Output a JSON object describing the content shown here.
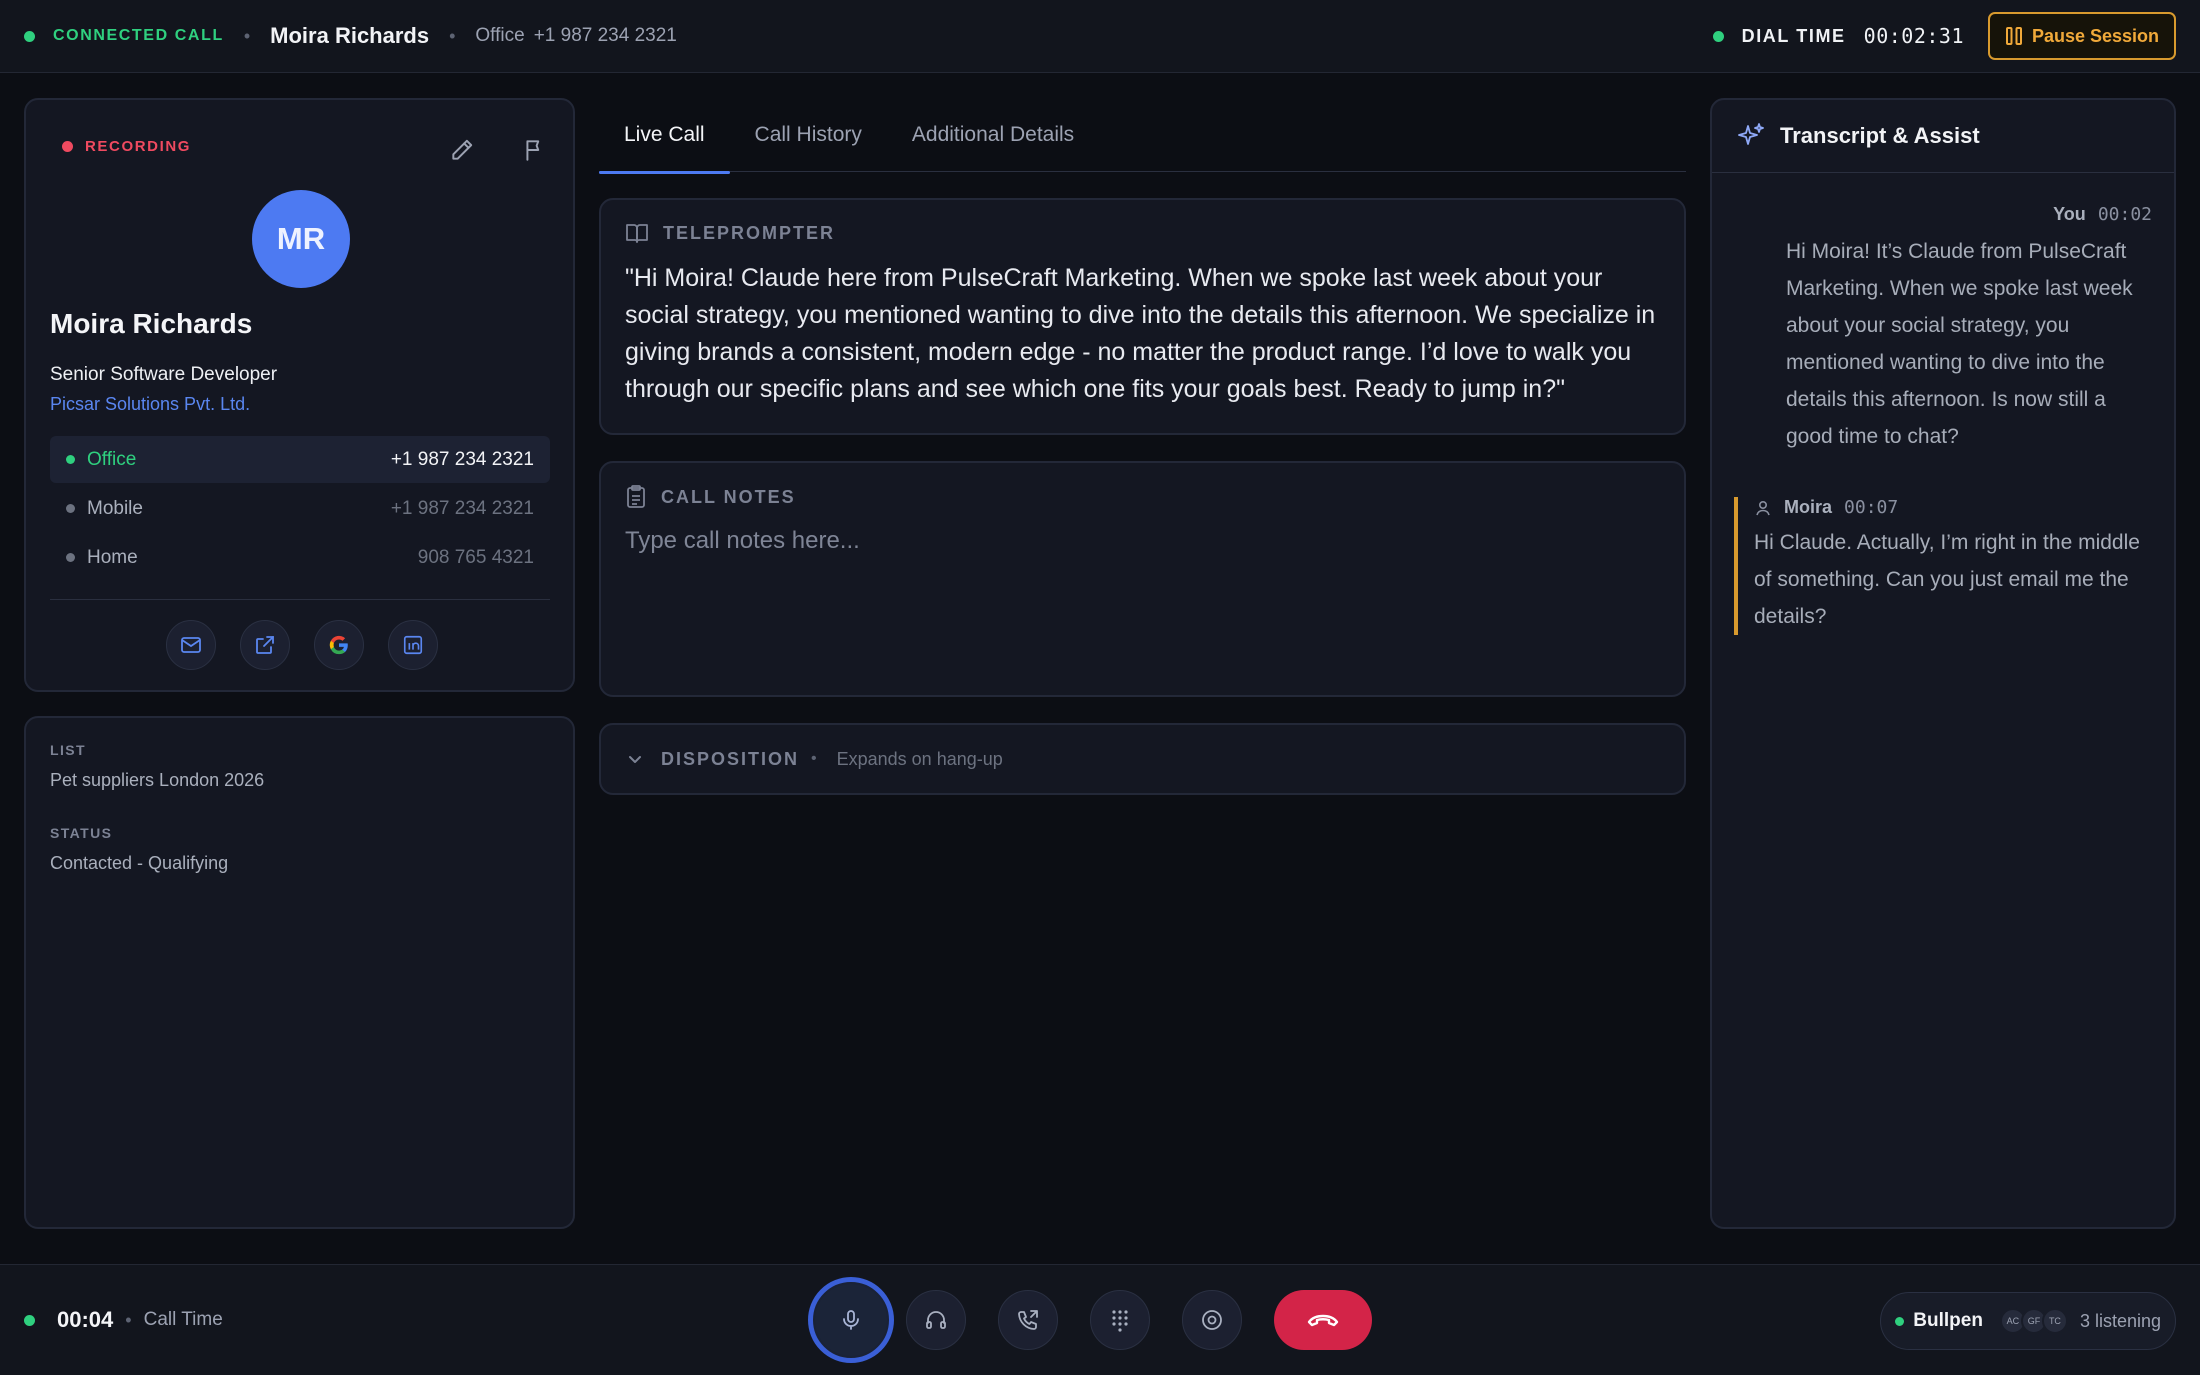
{
  "topbar": {
    "status": "CONNECTED CALL",
    "contact_name": "Moira Richards",
    "line_type": "Office",
    "line_number": "+1 987 234 2321",
    "dial_label": "DIAL TIME",
    "dial_time": "00:02:31",
    "pause_label": "Pause Session"
  },
  "contact": {
    "recording_label": "RECORDING",
    "initials": "MR",
    "name": "Moira Richards",
    "title": "Senior Software Developer",
    "company": "Picsar Solutions Pvt. Ltd.",
    "phones": [
      {
        "label": "Office",
        "number": "+1 987 234 2321",
        "active": true
      },
      {
        "label": "Mobile",
        "number": "+1 987 234 2321",
        "active": false
      },
      {
        "label": "Home",
        "number": "908 765 4321",
        "active": false
      }
    ],
    "social_icons": [
      "mail-icon",
      "external-link-icon",
      "google-icon",
      "linkedin-icon"
    ]
  },
  "meta": {
    "list_label": "LIST",
    "list_value": "Pet suppliers London 2026",
    "status_label": "STATUS",
    "status_value": "Contacted - Qualifying"
  },
  "tabs": [
    {
      "label": "Live Call",
      "active": true
    },
    {
      "label": "Call History",
      "active": false
    },
    {
      "label": "Additional Details",
      "active": false
    }
  ],
  "teleprompter": {
    "title": "TELEPROMPTER",
    "text": "\"Hi Moira! Claude here from PulseCraft Marketing. When we spoke last week about your social strategy, you mentioned wanting to dive into the details this afternoon. We specialize in giving brands a consistent, modern edge - no matter the product range. I’d love to walk you through our specific plans and see which one fits your goals best. Ready to jump in?\""
  },
  "notes": {
    "title": "CALL NOTES",
    "placeholder": "Type call notes here..."
  },
  "disposition": {
    "title": "DISPOSITION",
    "hint": "Expands on hang-up"
  },
  "assist": {
    "title": "Transcript & Assist",
    "messages": [
      {
        "who": "You",
        "time": "00:02",
        "text": "Hi Moira! It’s Claude from PulseCraft Marketing. When we spoke last week about your social strategy, you mentioned wanting to dive into the details this afternoon. Is now still a good time to chat?"
      },
      {
        "who": "Moira",
        "time": "00:07",
        "text": "Hi Claude. Actually, I’m right in the middle of something. Can you just email me the details?"
      }
    ]
  },
  "bottombar": {
    "call_time": "00:04",
    "call_time_label": "Call Time",
    "bullpen_label": "Bullpen",
    "bullpen_avatars": [
      "AC",
      "GF",
      "TC"
    ],
    "bullpen_count": "3 listening"
  },
  "colors": {
    "accent": "#4d7af2",
    "connected": "#2fd07f",
    "recording": "#ef4a60",
    "pause": "#d89a2e",
    "hangup": "#d32448"
  }
}
